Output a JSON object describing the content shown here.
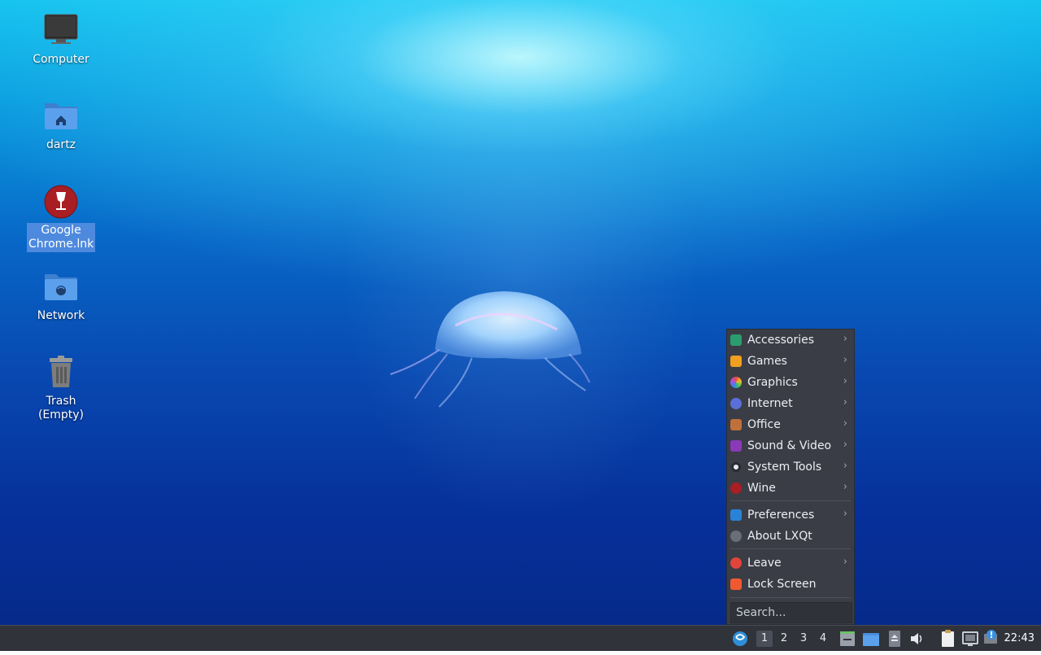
{
  "desktop": {
    "icons": [
      {
        "label": "Computer",
        "icon": "computer-icon"
      },
      {
        "label": "dartz",
        "icon": "home-folder-icon"
      },
      {
        "label": "Google Chrome.lnk",
        "icon": "wine-shortcut-icon",
        "selected": true
      },
      {
        "label": "Network",
        "icon": "network-folder-icon"
      },
      {
        "label": "Trash (Empty)",
        "icon": "trash-icon"
      }
    ]
  },
  "menu": {
    "items": [
      {
        "label": "Accessories",
        "icon": "accessories-icon",
        "submenu": true
      },
      {
        "label": "Games",
        "icon": "games-icon",
        "submenu": true
      },
      {
        "label": "Graphics",
        "icon": "graphics-icon",
        "submenu": true
      },
      {
        "label": "Internet",
        "icon": "internet-icon",
        "submenu": true
      },
      {
        "label": "Office",
        "icon": "office-icon",
        "submenu": true
      },
      {
        "label": "Sound & Video",
        "icon": "sound-video-icon",
        "submenu": true
      },
      {
        "label": "System Tools",
        "icon": "system-tools-icon",
        "submenu": true
      },
      {
        "label": "Wine",
        "icon": "wine-icon",
        "submenu": true
      },
      {
        "label": "Preferences",
        "icon": "preferences-icon",
        "submenu": true
      },
      {
        "label": "About LXQt",
        "icon": "info-icon",
        "submenu": false
      },
      {
        "label": "Leave",
        "icon": "power-icon",
        "submenu": true
      },
      {
        "label": "Lock Screen",
        "icon": "lock-icon",
        "submenu": false
      }
    ],
    "arrow": "›",
    "search_placeholder": "Search..."
  },
  "taskbar": {
    "workspaces": [
      "1",
      "2",
      "3",
      "4"
    ],
    "active_workspace": "1",
    "clock": "22:43"
  },
  "colors": {
    "menu_bg": "#3a3d45",
    "taskbar_bg": "#30333a",
    "selection": "#6496e6"
  }
}
